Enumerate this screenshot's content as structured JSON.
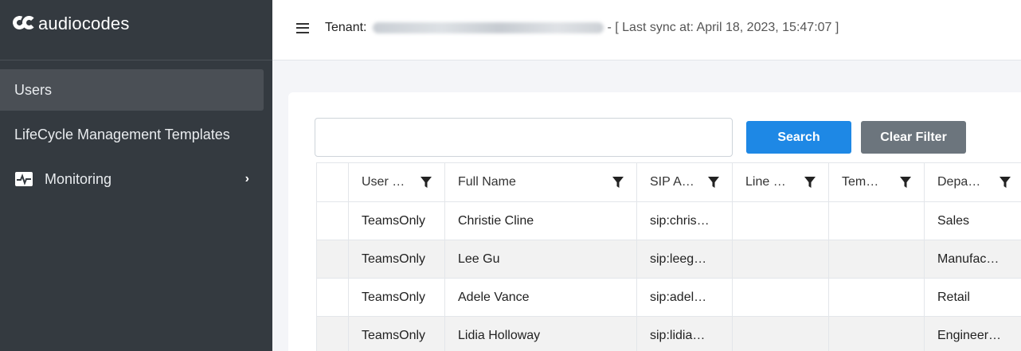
{
  "brand": {
    "name": "audiocodes"
  },
  "sidebar": {
    "items": [
      {
        "label": "Users",
        "active": true
      },
      {
        "label": "LifeCycle Management Templates"
      },
      {
        "label": "Monitoring",
        "icon": "monitor-pulse-icon",
        "has_submenu": true
      }
    ]
  },
  "header": {
    "menu_icon": "hamburger-icon",
    "tenant_label": "Tenant:",
    "sync_text": "- [ Last sync at: April 18, 2023, 15:47:07 ]"
  },
  "filters": {
    "search_value": "",
    "search_button": "Search",
    "clear_button": "Clear Filter"
  },
  "table": {
    "filter_icon": "funnel-icon",
    "columns": [
      "User …",
      "Full Name",
      "SIP A…",
      "Line …",
      "Tem…",
      "Depa…"
    ],
    "rows": [
      [
        "TeamsOnly",
        "Christie Cline",
        "sip:chris…",
        "",
        "",
        "Sales"
      ],
      [
        "TeamsOnly",
        "Lee Gu",
        "sip:leeg…",
        "",
        "",
        "Manufac…"
      ],
      [
        "TeamsOnly",
        "Adele Vance",
        "sip:adel…",
        "",
        "",
        "Retail"
      ],
      [
        "TeamsOnly",
        "Lidia Holloway",
        "sip:lidia…",
        "",
        "",
        "Engineer…"
      ]
    ]
  },
  "colors": {
    "sidebar_bg": "#343a40",
    "primary": "#1e88e5",
    "secondary": "#6c757d"
  }
}
